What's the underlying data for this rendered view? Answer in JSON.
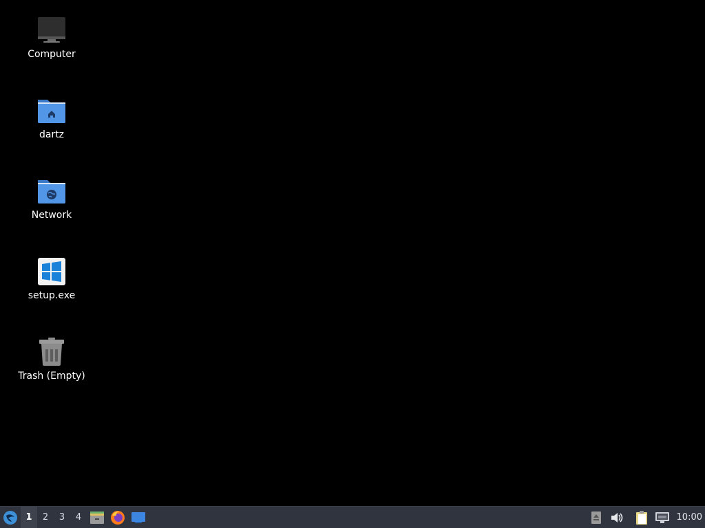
{
  "desktop": {
    "icons": [
      {
        "label": "Computer",
        "icon": "computer-icon"
      },
      {
        "label": "dartz",
        "icon": "home-folder-icon"
      },
      {
        "label": "Network",
        "icon": "network-folder-icon"
      },
      {
        "label": "setup.exe",
        "icon": "windows-exe-icon"
      },
      {
        "label": "Trash (Empty)",
        "icon": "trash-icon"
      }
    ]
  },
  "panel": {
    "workspaces": [
      "1",
      "2",
      "3",
      "4"
    ],
    "active_workspace": "1",
    "launchers": [
      "file-manager-icon",
      "firefox-icon",
      "desktop-icon"
    ],
    "tray": [
      "removable-media-icon",
      "volume-icon",
      "clipboard-icon",
      "network-wired-icon"
    ],
    "clock": "10:00"
  },
  "colors": {
    "background": "#000000",
    "panel": "#2f343f",
    "folder_blue": "#4a8fe0"
  }
}
